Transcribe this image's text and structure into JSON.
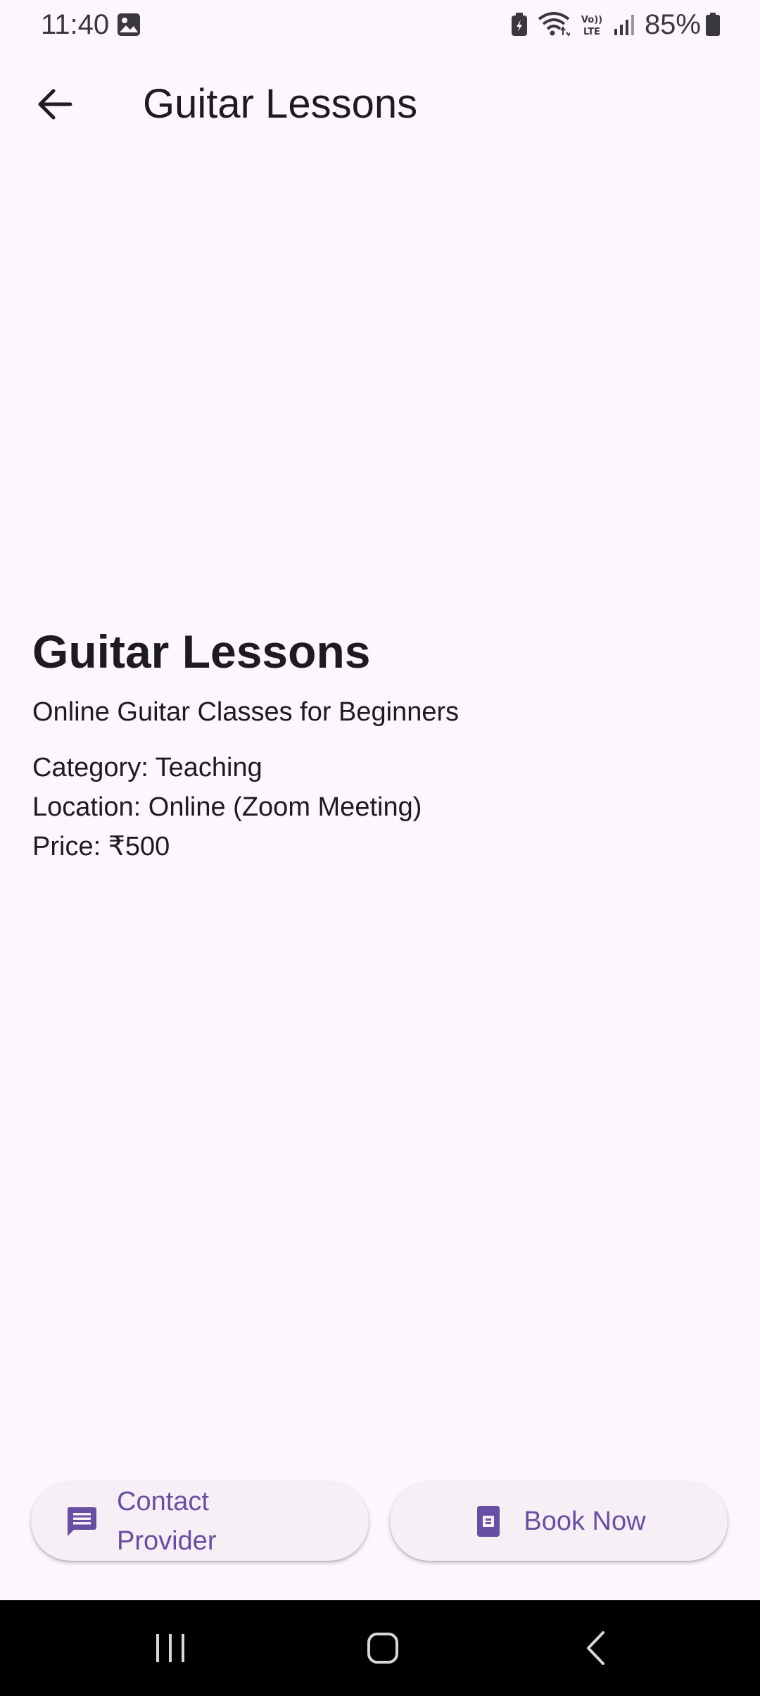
{
  "status_bar": {
    "time": "11:40",
    "battery_percent": "85%",
    "icons": [
      "gallery-icon",
      "battery-saver-icon",
      "wifi-icon",
      "volte-icon",
      "signal-icon",
      "battery-icon"
    ]
  },
  "app_bar": {
    "title": "Guitar Lessons",
    "back_icon": "arrow-back-icon"
  },
  "service": {
    "title": "Guitar Lessons",
    "subtitle": "Online Guitar Classes for Beginners",
    "category": "Category: Teaching",
    "location": "Location: Online (Zoom Meeting)",
    "price": "Price: ₹500"
  },
  "actions": {
    "contact_label": "Contact Provider",
    "contact_icon": "message-icon",
    "book_label": "Book Now",
    "book_icon": "book-icon"
  },
  "nav": {
    "icons": [
      "recents-icon",
      "home-icon",
      "back-icon"
    ]
  },
  "colors": {
    "background": "#fdf7fd",
    "accent": "#6750a4",
    "button_bg": "#f6eff6",
    "text": "#1d1b20"
  }
}
